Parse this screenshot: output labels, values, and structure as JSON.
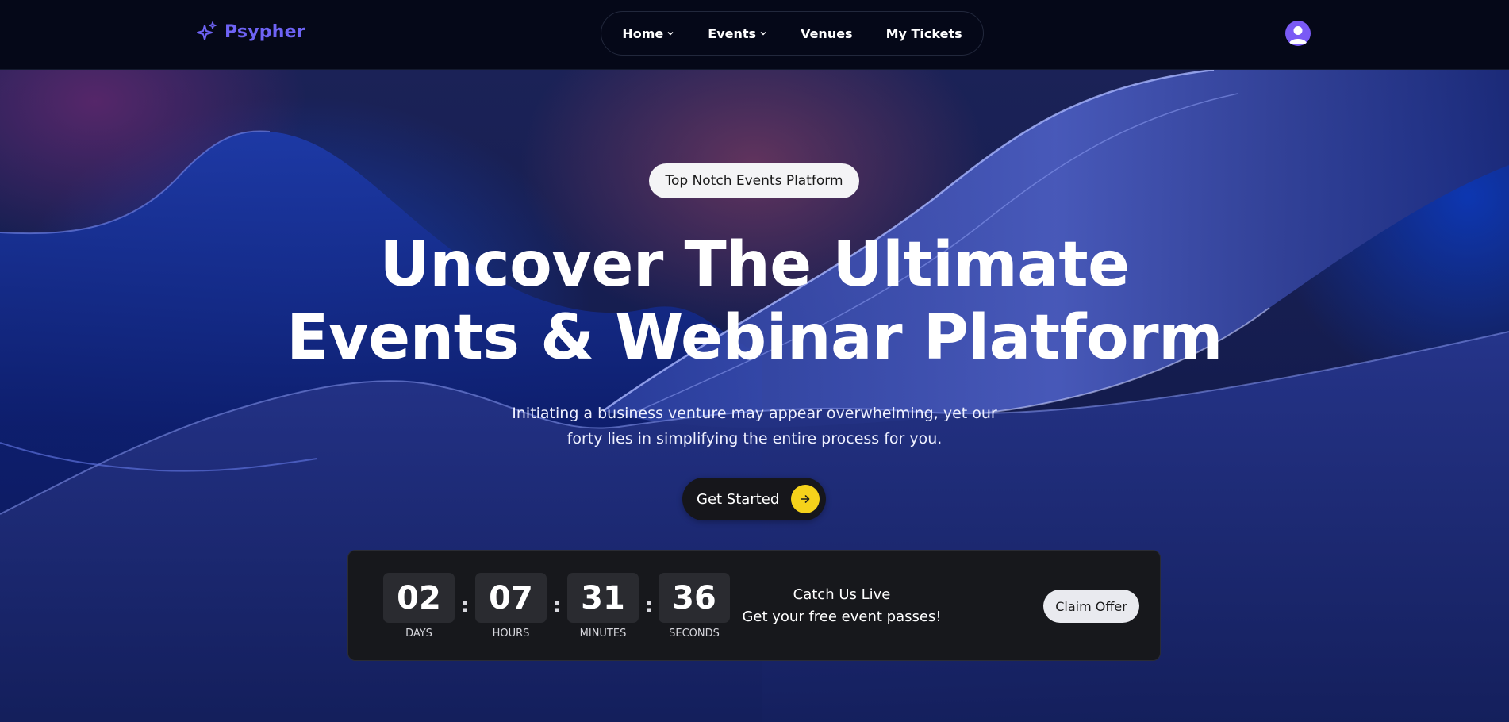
{
  "brand": {
    "name": "Psypher",
    "icon": "sparkle-icon",
    "color": "#6e63f5"
  },
  "nav": {
    "items": [
      {
        "label": "Home",
        "has_dropdown": true
      },
      {
        "label": "Events",
        "has_dropdown": true
      },
      {
        "label": "Venues",
        "has_dropdown": false
      },
      {
        "label": "My Tickets",
        "has_dropdown": false
      }
    ],
    "avatar_icon": "user-avatar-icon",
    "avatar_color": "#7a5af5"
  },
  "hero": {
    "badge": "Top Notch Events Platform",
    "headline_line1": "Uncover The Ultimate",
    "headline_line2": "Events & Webinar Platform",
    "subtitle_line1": "Initiating a business venture may appear overwhelming, yet our",
    "subtitle_line2": "forty lies in simplifying the entire process for you.",
    "cta_label": "Get Started",
    "cta_icon": "arrow-right-icon",
    "cta_accent": "#f5d21b"
  },
  "countdown": {
    "units": [
      {
        "value": "02",
        "label": "DAYS"
      },
      {
        "value": "07",
        "label": "HOURS"
      },
      {
        "value": "31",
        "label": "MINUTES"
      },
      {
        "value": "36",
        "label": "SECONDS"
      }
    ],
    "separator": ":",
    "promo_line1": "Catch Us Live",
    "promo_line2": "Get your free event passes!",
    "claim_label": "Claim Offer"
  }
}
